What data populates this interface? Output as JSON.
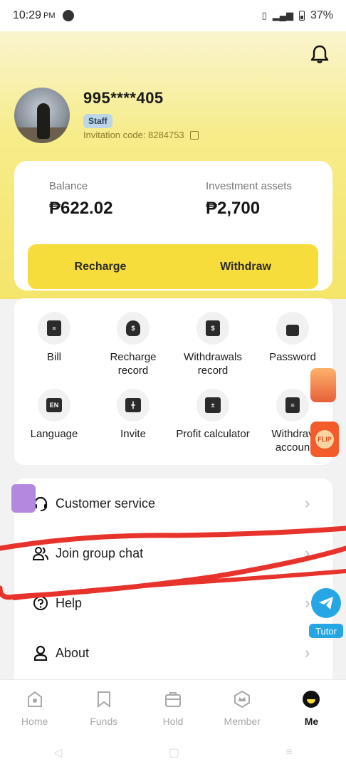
{
  "status_bar": {
    "time": "10:29",
    "ampm": "PM",
    "battery": "37%"
  },
  "profile": {
    "phone": "995****405",
    "badge": "Staff",
    "invitation_code_label": "Invitation code: 8284753"
  },
  "balance_card": {
    "balance_label": "Balance",
    "balance_value": "₱622.02",
    "investment_label": "Investment assets",
    "investment_value": "₱2,700",
    "recharge_button": "Recharge",
    "withdraw_button": "Withdraw"
  },
  "grid": [
    {
      "line1": "Bill",
      "line2": "",
      "icon": "bill-icon"
    },
    {
      "line1": "Recharge",
      "line2": "record",
      "icon": "money-bag-icon"
    },
    {
      "line1": "Withdrawals",
      "line2": "record",
      "icon": "wallet-icon"
    },
    {
      "line1": "Password",
      "line2": "",
      "icon": "lock-icon"
    },
    {
      "line1": "Language",
      "line2": "",
      "icon": "language-icon",
      "glyph": "EN"
    },
    {
      "line1": "Invite",
      "line2": "",
      "icon": "gift-icon"
    },
    {
      "line1": "Profit calculator",
      "line2": "",
      "icon": "calculator-icon"
    },
    {
      "line1": "Withdrav",
      "line2": "accoun",
      "icon": "withdraw-account-icon"
    }
  ],
  "list": [
    {
      "label": "Customer service",
      "icon": "headset-icon"
    },
    {
      "label": "Join group chat",
      "icon": "group-icon"
    },
    {
      "label": "Help",
      "icon": "help-icon"
    },
    {
      "label": "About",
      "icon": "user-icon"
    }
  ],
  "floating": {
    "tutor_label": "Tutor",
    "flip_label": "FLIP"
  },
  "bottom_nav": [
    {
      "label": "Home",
      "icon": "home-icon",
      "active": false
    },
    {
      "label": "Funds",
      "icon": "bookmark-icon",
      "active": false
    },
    {
      "label": "Hold",
      "icon": "briefcase-icon",
      "active": false
    },
    {
      "label": "Member",
      "icon": "crown-icon",
      "active": false
    },
    {
      "label": "Me",
      "icon": "me-icon",
      "active": true
    }
  ],
  "colors": {
    "accent_yellow": "#f7dd3c",
    "scribble_red": "#e8322c",
    "tutor_blue": "#27a6e5"
  }
}
